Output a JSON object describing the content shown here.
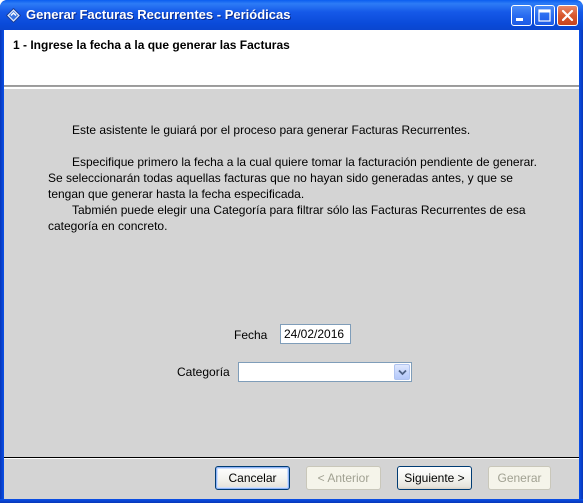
{
  "window": {
    "title": "Generar Facturas Recurrentes - Periódicas"
  },
  "header": {
    "step_title": "1 - Ingrese la fecha a la que generar las Facturas"
  },
  "body": {
    "paragraph1": "Este asistente le guiará por el proceso para generar Facturas Recurrentes.",
    "paragraph2": "Especifique primero la fecha a la cual quiere tomar la facturación pendiente de generar. Se seleccionarán todas aquellas facturas que no hayan sido generadas antes, y que se tengan que generar hasta la fecha especificada.",
    "paragraph3": "Tabmién puede elegir una Categoría para filtrar sólo las Facturas Recurrentes de esa categoría en concreto."
  },
  "form": {
    "fecha_label": "Fecha",
    "fecha_value": "24/02/2016",
    "categoria_label": "Categoría",
    "categoria_value": ""
  },
  "buttons": {
    "cancel": "Cancelar",
    "prev": "< Anterior",
    "next": "Siguiente >",
    "generate": "Generar"
  },
  "colors": {
    "titlebar": "#0a4ad9",
    "client_bg": "#d4d4d4",
    "header_bg": "#ffffff"
  },
  "icons": {
    "app": "app-logo-icon",
    "minimize": "minimize-icon",
    "maximize": "maximize-icon",
    "close": "close-icon",
    "dropdown": "chevron-down-icon"
  }
}
